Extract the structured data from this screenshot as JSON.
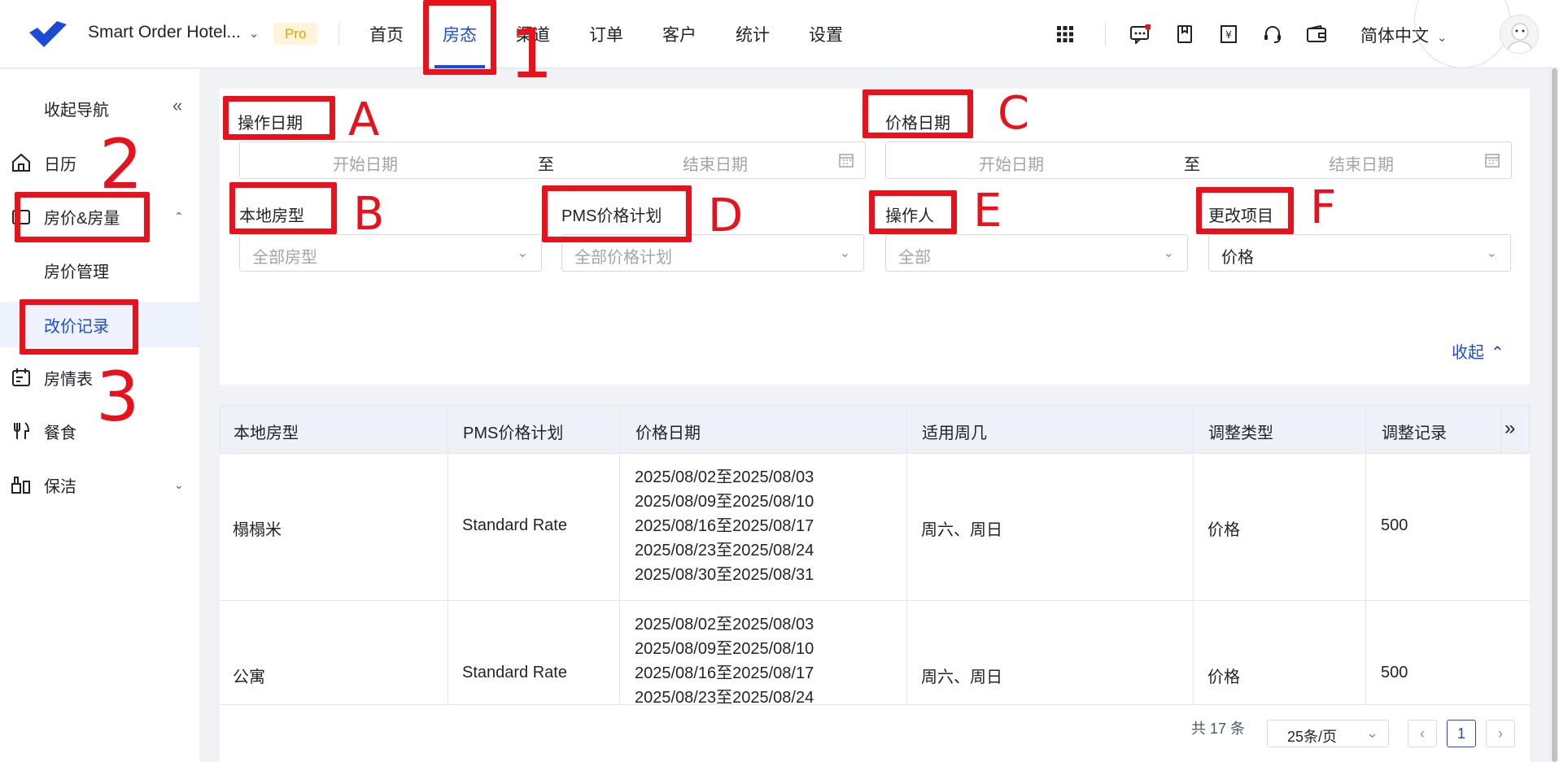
{
  "header": {
    "hotel_name": "Smart Order Hotel...",
    "badge": "Pro",
    "nav": [
      "首页",
      "房态",
      "渠道",
      "订单",
      "客户",
      "统计",
      "设置"
    ],
    "active_nav": "房态",
    "language": "简体中文",
    "icons": [
      "apps-grid-icon",
      "message-icon",
      "book-icon",
      "invoice-icon",
      "headset-icon",
      "wallet-icon"
    ]
  },
  "sidebar": {
    "collapse_label": "收起导航",
    "items": [
      {
        "label": "日历",
        "icon": "home-icon"
      },
      {
        "label": "房价&房量",
        "icon": "tag-icon"
      },
      {
        "label": "房价管理",
        "icon": ""
      },
      {
        "label": "改价记录",
        "icon": ""
      },
      {
        "label": "房情表",
        "icon": "calendar-icon"
      },
      {
        "label": "餐食",
        "icon": "cutlery-icon"
      },
      {
        "label": "保洁",
        "icon": "cleaning-icon"
      }
    ]
  },
  "filters": {
    "op_date_label": "操作日期",
    "price_date_label": "价格日期",
    "start_placeholder": "开始日期",
    "end_placeholder": "结束日期",
    "to": "至",
    "room_type_label": "本地房型",
    "room_type_placeholder": "全部房型",
    "pms_plan_label": "PMS价格计划",
    "pms_plan_placeholder": "全部价格计划",
    "operator_label": "操作人",
    "operator_placeholder": "全部",
    "change_item_label": "更改项目",
    "change_item_value": "价格",
    "fold_label": "收起"
  },
  "table": {
    "columns": [
      "本地房型",
      "PMS价格计划",
      "价格日期",
      "适用周几",
      "调整类型",
      "调整记录"
    ],
    "rows": [
      {
        "room": "榻榻米",
        "plan": "Standard Rate",
        "dates": [
          "2025/08/02至2025/08/03",
          "2025/08/09至2025/08/10",
          "2025/08/16至2025/08/17",
          "2025/08/23至2025/08/24",
          "2025/08/30至2025/08/31"
        ],
        "weekdays": "周六、周日",
        "type": "价格",
        "record": "500"
      },
      {
        "room": "公寓",
        "plan": "Standard Rate",
        "dates": [
          "2025/08/02至2025/08/03",
          "2025/08/09至2025/08/10",
          "2025/08/16至2025/08/17",
          "2025/08/23至2025/08/24"
        ],
        "weekdays": "周六、周日",
        "type": "价格",
        "record": "500"
      }
    ]
  },
  "pagination": {
    "total": "共 17 条",
    "page_size": "25条/页",
    "current_page": "1"
  },
  "annotations": {
    "numbers": [
      "1",
      "2",
      "3"
    ],
    "letters": [
      "A",
      "B",
      "C",
      "D",
      "E",
      "F"
    ],
    "color": "#e8121d"
  },
  "colors": {
    "accent": "#1d4bd8",
    "annotation": "#e8121d"
  }
}
